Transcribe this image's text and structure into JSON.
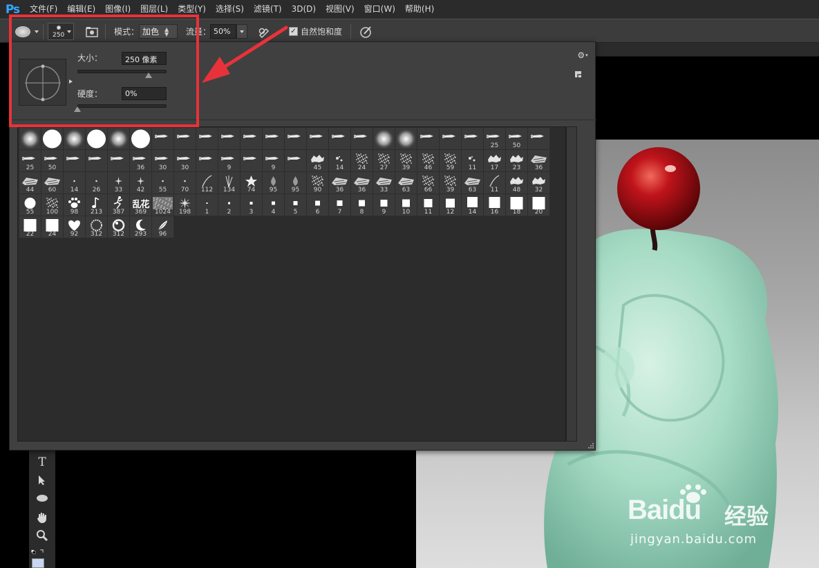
{
  "app": {
    "logo": "Ps"
  },
  "menu": [
    "文件(F)",
    "编辑(E)",
    "图像(I)",
    "图层(L)",
    "类型(Y)",
    "选择(S)",
    "滤镜(T)",
    "3D(D)",
    "视图(V)",
    "窗口(W)",
    "帮助(H)"
  ],
  "options": {
    "brush_size": "250",
    "mode_label": "模式：",
    "mode_value": "加色",
    "flow_label": "流量：",
    "flow_value": "50%",
    "saturation_label": "自然饱和度",
    "saturation_checked": true
  },
  "picker": {
    "size_label": "大小：",
    "size_value": "250 像素",
    "size_slider_fraction": 0.8,
    "hardness_label": "硬度：",
    "hardness_value": "0%",
    "hardness_slider_fraction": 0.0
  },
  "brushes": [
    {
      "k": "soft",
      "n": ""
    },
    {
      "k": "hard",
      "n": ""
    },
    {
      "k": "soft",
      "n": ""
    },
    {
      "k": "hard",
      "n": ""
    },
    {
      "k": "soft",
      "n": ""
    },
    {
      "k": "hard",
      "n": ""
    },
    {
      "k": "tip",
      "n": ""
    },
    {
      "k": "tip",
      "n": ""
    },
    {
      "k": "tip",
      "n": ""
    },
    {
      "k": "tip",
      "n": ""
    },
    {
      "k": "tip",
      "n": ""
    },
    {
      "k": "tip",
      "n": ""
    },
    {
      "k": "tip",
      "n": ""
    },
    {
      "k": "tip",
      "n": ""
    },
    {
      "k": "tip",
      "n": ""
    },
    {
      "k": "tip",
      "n": ""
    },
    {
      "k": "soft",
      "n": ""
    },
    {
      "k": "soft",
      "n": ""
    },
    {
      "k": "tip",
      "n": ""
    },
    {
      "k": "tip",
      "n": ""
    },
    {
      "k": "tip",
      "n": ""
    },
    {
      "k": "tip",
      "n": "25"
    },
    {
      "k": "tip",
      "n": "50"
    },
    {
      "k": "tip",
      "n": ""
    },
    {
      "k": "tip",
      "n": "25"
    },
    {
      "k": "tip",
      "n": "50"
    },
    {
      "k": "tip",
      "n": ""
    },
    {
      "k": "tip",
      "n": ""
    },
    {
      "k": "tip",
      "n": ""
    },
    {
      "k": "tip",
      "n": "36"
    },
    {
      "k": "tip",
      "n": "30"
    },
    {
      "k": "tip",
      "n": "30"
    },
    {
      "k": "tip",
      "n": ""
    },
    {
      "k": "tip",
      "n": "9"
    },
    {
      "k": "tip",
      "n": ""
    },
    {
      "k": "tip",
      "n": "9"
    },
    {
      "k": "tip",
      "n": ""
    },
    {
      "k": "splat",
      "n": "45"
    },
    {
      "k": "speck",
      "n": "14"
    },
    {
      "k": "spray",
      "n": "24"
    },
    {
      "k": "spray",
      "n": "27"
    },
    {
      "k": "spray",
      "n": "39"
    },
    {
      "k": "spray",
      "n": "46"
    },
    {
      "k": "spray",
      "n": "59"
    },
    {
      "k": "speck",
      "n": "11"
    },
    {
      "k": "splat",
      "n": "17"
    },
    {
      "k": "splat",
      "n": "23"
    },
    {
      "k": "chalk",
      "n": "36"
    },
    {
      "k": "chalk",
      "n": "44"
    },
    {
      "k": "chalk",
      "n": "60"
    },
    {
      "k": "dot",
      "n": "14"
    },
    {
      "k": "dot",
      "n": "26"
    },
    {
      "k": "star",
      "n": "33"
    },
    {
      "k": "star",
      "n": "42"
    },
    {
      "k": "dot",
      "n": "55"
    },
    {
      "k": "dot",
      "n": "70"
    },
    {
      "k": "line",
      "n": "112"
    },
    {
      "k": "grass",
      "n": "134"
    },
    {
      "k": "leaf",
      "n": "74"
    },
    {
      "k": "drop",
      "n": "95"
    },
    {
      "k": "drop",
      "n": "95"
    },
    {
      "k": "spray",
      "n": "90"
    },
    {
      "k": "chalk",
      "n": "36"
    },
    {
      "k": "chalk",
      "n": "36"
    },
    {
      "k": "chalk",
      "n": "33"
    },
    {
      "k": "chalk",
      "n": "63"
    },
    {
      "k": "spray",
      "n": "66"
    },
    {
      "k": "spray",
      "n": "39"
    },
    {
      "k": "chalk",
      "n": "63"
    },
    {
      "k": "line",
      "n": "11"
    },
    {
      "k": "splat",
      "n": "48"
    },
    {
      "k": "splat",
      "n": "32"
    },
    {
      "k": "circle",
      "n": "55"
    },
    {
      "k": "spray",
      "n": "100"
    },
    {
      "k": "paw",
      "n": "98"
    },
    {
      "k": "note",
      "n": "213"
    },
    {
      "k": "figure",
      "n": "387"
    },
    {
      "k": "text",
      "n": "369"
    },
    {
      "k": "texture",
      "n": "1024"
    },
    {
      "k": "starburst",
      "n": "198"
    },
    {
      "k": "sq",
      "n": "1",
      "s": 2
    },
    {
      "k": "sq",
      "n": "2",
      "s": 3
    },
    {
      "k": "sq",
      "n": "3",
      "s": 4
    },
    {
      "k": "sq",
      "n": "4",
      "s": 5
    },
    {
      "k": "sq",
      "n": "5",
      "s": 6
    },
    {
      "k": "sq",
      "n": "6",
      "s": 7
    },
    {
      "k": "sq",
      "n": "7",
      "s": 8
    },
    {
      "k": "sq",
      "n": "8",
      "s": 9
    },
    {
      "k": "sq",
      "n": "9",
      "s": 10
    },
    {
      "k": "sq",
      "n": "10",
      "s": 11
    },
    {
      "k": "sq",
      "n": "11",
      "s": 12
    },
    {
      "k": "sq",
      "n": "12",
      "s": 13
    },
    {
      "k": "sq",
      "n": "14",
      "s": 15
    },
    {
      "k": "sq",
      "n": "16",
      "s": 16
    },
    {
      "k": "sq",
      "n": "18",
      "s": 18
    },
    {
      "k": "sq",
      "n": "20",
      "s": 18
    },
    {
      "k": "sq",
      "n": "22",
      "s": 18
    },
    {
      "k": "sq",
      "n": "24",
      "s": 18
    },
    {
      "k": "heart",
      "n": "92"
    },
    {
      "k": "ring",
      "n": "312"
    },
    {
      "k": "ring2",
      "n": "312"
    },
    {
      "k": "moon",
      "n": "293"
    },
    {
      "k": "feather",
      "n": "96"
    }
  ],
  "brush_text_glyph": "乱花",
  "watermark": {
    "logo": "Bai",
    "logo_du": "du",
    "cn": "经验",
    "url": "jingyan.baidu.com"
  },
  "colors": {
    "annotation": "#e8323a",
    "ps_blue": "#31a8ff",
    "bead": "#b0151b",
    "jade": "#a9dcc4"
  }
}
